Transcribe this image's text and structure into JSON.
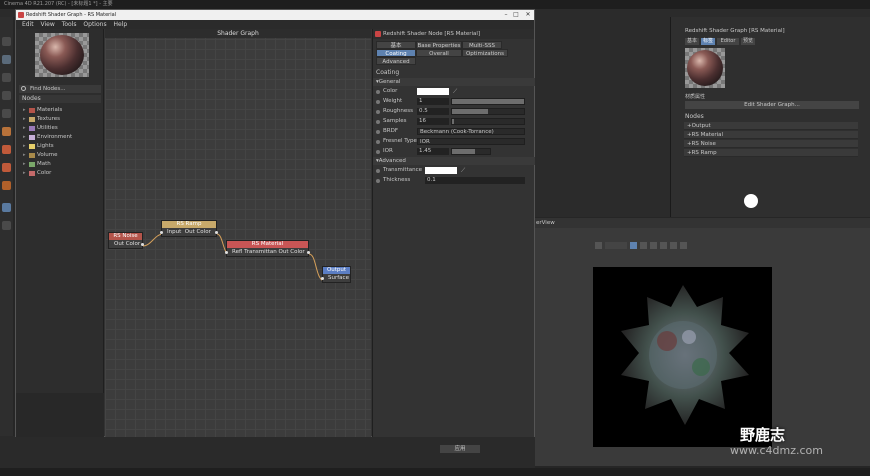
{
  "colors": {
    "node_noise_header": "#b4544a",
    "node_ramp_header": "#c7a96a",
    "node_material_header": "#c85555",
    "node_output_header": "#5b7ec4",
    "wire": "#d6a05a",
    "accent_tab": "#5e82b0"
  },
  "background": {
    "app_title": "Cinema 4D R21.207 (RC) - [未标题1 *] - 主要",
    "right_panel_title": "Redshift Shader Graph [RS Material]",
    "right_tabs": [
      "基本",
      "标签",
      "Editor",
      "预览"
    ],
    "edit_shader_graph": "Edit Shader Graph...",
    "material_label": "材质属性",
    "nodes_header": "Nodes",
    "am_items": [
      "Output",
      "RS Material",
      "RS Noise",
      "RS Ramp"
    ],
    "viewport_title": "erView",
    "apply_button": "应用"
  },
  "window": {
    "title": "Redshift Shader Graph - RS Material",
    "minimize": "–",
    "maximize": "□",
    "close": "✕",
    "menu": [
      "Edit",
      "View",
      "Tools",
      "Options",
      "Help"
    ]
  },
  "left_panel": {
    "find_nodes": "Find Nodes...",
    "nodes_header": "Nodes",
    "categories": [
      {
        "label": "Materials",
        "color": "#b4544a"
      },
      {
        "label": "Textures",
        "color": "#c7a96a"
      },
      {
        "label": "Utilities",
        "color": "#9a7ab8"
      },
      {
        "label": "Environment",
        "color": "#c7b0d8"
      },
      {
        "label": "Lights",
        "color": "#e6cf6a"
      },
      {
        "label": "Volume",
        "color": "#a88a4a"
      },
      {
        "label": "Math",
        "color": "#7aa86a"
      },
      {
        "label": "Color",
        "color": "#c46a6a"
      }
    ]
  },
  "graph": {
    "title": "Shader Graph",
    "nodes": {
      "noise": {
        "title": "RS Noise",
        "out": "Out Color"
      },
      "ramp": {
        "title": "RS Ramp",
        "in": "Input",
        "out": "Out Color"
      },
      "material": {
        "title": "RS Material",
        "in": "Refl Transmittan",
        "out": "Out Color"
      },
      "output": {
        "title": "Output",
        "in": "Surface"
      }
    }
  },
  "right_panel": {
    "title": "Redshift Shader Node [RS Material]",
    "tabs_row1": [
      "基本",
      "Base Properties",
      "Multi-SSS"
    ],
    "tabs_row2": [
      "Coating",
      "Overall",
      "Optimizations"
    ],
    "tabs_row3": [
      "Advanced"
    ],
    "section": "Coating",
    "group_general": "▾General",
    "group_advanced": "▾Advanced",
    "props": {
      "color": {
        "label": "Color"
      },
      "weight": {
        "label": "Weight",
        "value": "1",
        "fill": 1.0
      },
      "roughness": {
        "label": "Roughness",
        "value": "0.5",
        "fill": 0.5
      },
      "samples": {
        "label": "Samples",
        "value": "16",
        "fill": 0.03
      },
      "brdf": {
        "label": "BRDF",
        "value": "Beckmann (Cook-Torrance)"
      },
      "fresnel": {
        "label": "Fresnel Type",
        "value": "IOR"
      },
      "ior": {
        "label": "IOR",
        "value": "1.45",
        "fill": 0.6
      },
      "transmittance": {
        "label": "Transmittance"
      },
      "thickness": {
        "label": "Thickness",
        "value": "0.1"
      }
    }
  },
  "watermark": {
    "text": "野鹿志",
    "sub": "www.c4dmz.com"
  }
}
